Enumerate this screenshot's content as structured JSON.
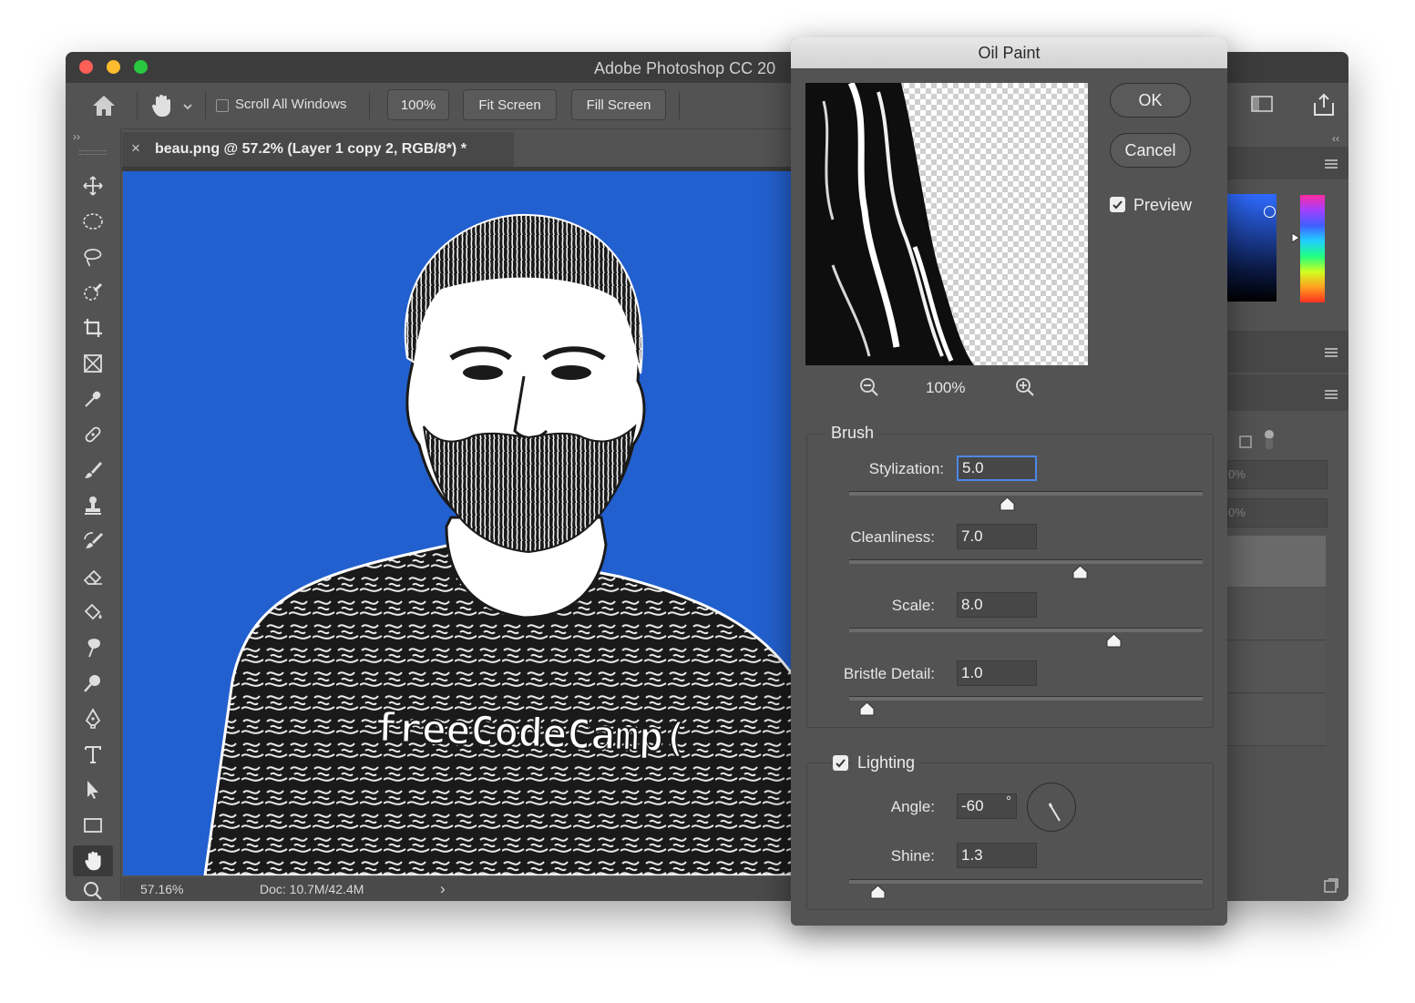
{
  "window": {
    "title": "Adobe Photoshop CC 20"
  },
  "options_bar": {
    "scroll_all_windows": "Scroll All Windows",
    "zoom": "100%",
    "fit_screen": "Fit Screen",
    "fill_screen": "Fill Screen"
  },
  "document": {
    "tab_title": "beau.png @ 57.2% (Layer 1 copy 2, RGB/8*) *",
    "tab_close": "×",
    "shirt_text": "freeCodeCamp("
  },
  "status_bar": {
    "zoom": "57.16%",
    "doc_size": "Doc: 10.7M/42.4M",
    "arrow": "›"
  },
  "right_panel": {
    "opacity_partial": "0%",
    "fill_partial": "0%"
  },
  "dialog": {
    "title": "Oil Paint",
    "ok": "OK",
    "cancel": "Cancel",
    "preview_label": "Preview",
    "preview_checked": true,
    "preview_zoom": "100%",
    "brush": {
      "title": "Brush",
      "stylization": {
        "label": "Stylization:",
        "value": "5.0"
      },
      "cleanliness": {
        "label": "Cleanliness:",
        "value": "7.0"
      },
      "scale": {
        "label": "Scale:",
        "value": "8.0"
      },
      "bristle": {
        "label": "Bristle Detail:",
        "value": "1.0"
      }
    },
    "lighting": {
      "title": "Lighting",
      "checked": true,
      "angle": {
        "label": "Angle:",
        "value": "-60",
        "unit": "°"
      },
      "shine": {
        "label": "Shine:",
        "value": "1.3"
      }
    }
  },
  "colors": {
    "canvas_blue": "#2360cf",
    "focus_blue": "#4c88e8",
    "close": "#fe5f57",
    "minimize": "#febc2e",
    "zoom": "#28c840"
  }
}
